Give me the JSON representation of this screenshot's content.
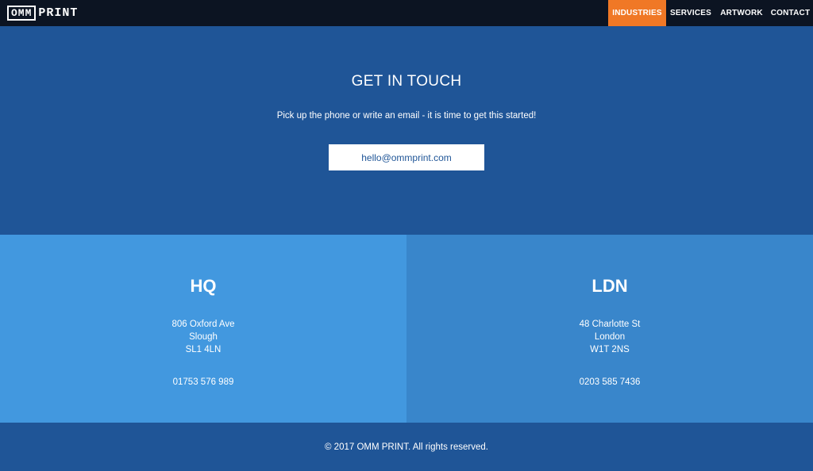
{
  "nav": {
    "logo_box": "OMM",
    "logo_word": "PRINT",
    "links": [
      {
        "label": "INDUSTRIES",
        "active": true
      },
      {
        "label": "SERVICES",
        "active": false
      },
      {
        "label": "ARTWORK",
        "active": false
      },
      {
        "label": "CONTACT",
        "active": false
      }
    ]
  },
  "hero": {
    "title": "GET IN TOUCH",
    "subtitle": "Pick up the phone or write an email - it is time to get this started!",
    "email": "hello@ommprint.com"
  },
  "offices": [
    {
      "title": "HQ",
      "address": [
        "806 Oxford Ave",
        "Slough",
        "SL1 4LN"
      ],
      "phone": "01753 576 989"
    },
    {
      "title": "LDN",
      "address": [
        "48 Charlotte St",
        "London",
        "W1T 2NS"
      ],
      "phone": "0203 585 7436"
    }
  ],
  "footer": {
    "copyright": "© 2017 OMM PRINT. All rights reserved."
  },
  "colors": {
    "navbar": "#0c1422",
    "accent": "#f07826",
    "hero": "#1f5597",
    "hq_panel": "#4298df",
    "ldn_panel": "#3986cb"
  }
}
